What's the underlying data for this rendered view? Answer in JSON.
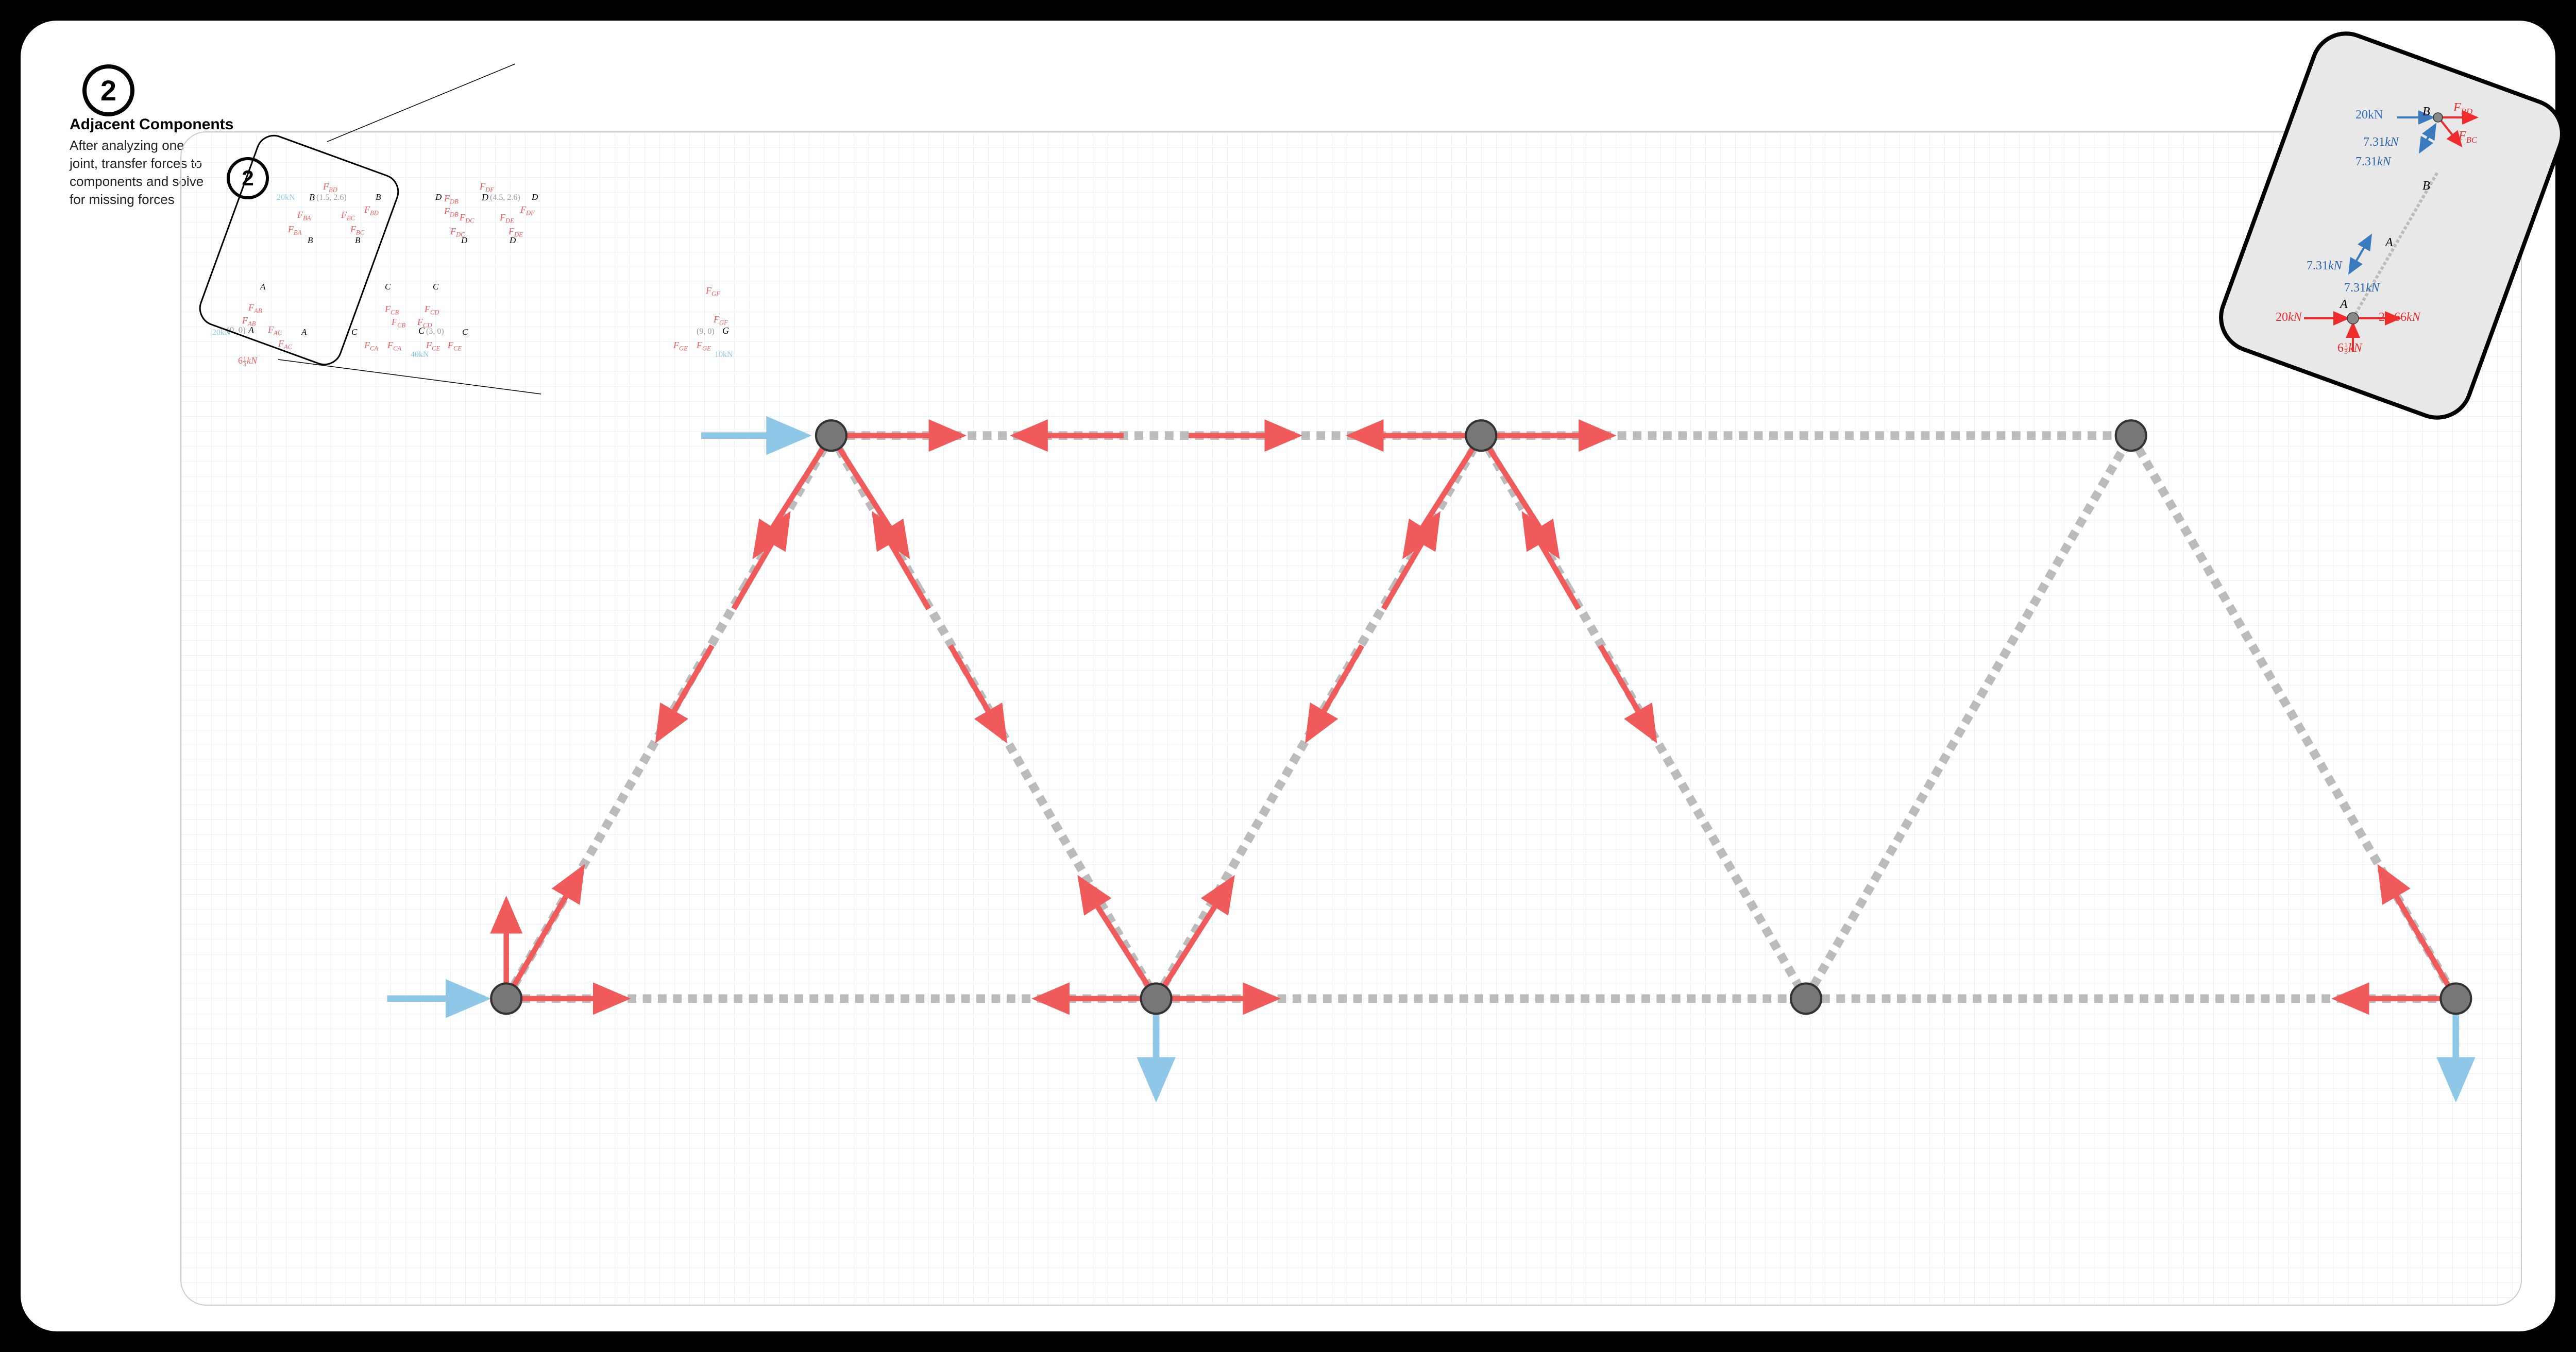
{
  "step": {
    "number": "2",
    "title": "Adjacent Components",
    "description": "After analyzing one joint, transfer forces to components and solve for missing forces"
  },
  "truss": {
    "joints": {
      "A": {
        "coord": "(0, 0)"
      },
      "B": {
        "coord": "(1.5, 2.6)"
      },
      "C": {
        "coord": "(3, 0)"
      },
      "D": {
        "coord": "(4.5, 2.6)"
      },
      "G": {
        "coord": "(9, 0)"
      }
    },
    "loads": {
      "Aext": "20kN",
      "Btop": "20kN",
      "Creact": "40kN",
      "Greact": "10kN",
      "Areact": "6⅓kN"
    },
    "forces": [
      "F_BD",
      "F_BA",
      "F_BC",
      "F_AB",
      "F_AC",
      "F_CA",
      "F_CE",
      "F_DB",
      "F_DF",
      "F_DC",
      "F_DE",
      "F_CB",
      "F_CD",
      "F_GF",
      "F_GE"
    ]
  },
  "zoom": {
    "A": "A",
    "B": "B",
    "FBD": "F_BD",
    "FBC": "F_BC",
    "v20": "20kN",
    "v731a": "7.31kN",
    "v731b": "7.31kN",
    "v731c": "7.31kN",
    "v731d": "7.31kN",
    "v2366": "23.66kN",
    "v613": "6⅓kN",
    "vA20": "20kN"
  },
  "lbl": {
    "A": "A",
    "B": "B",
    "C": "C",
    "D": "D",
    "G": "G",
    "FBD": "F",
    "BD": "BD",
    "FBA": "F",
    "BA": "BA",
    "FBC": "F",
    "BC": "BC",
    "FAB": "F",
    "AB": "AB",
    "FAC": "F",
    "AC": "AC",
    "FCA": "F",
    "CA": "CA",
    "FCE": "F",
    "CE": "CE",
    "FDB": "F",
    "DB": "DB",
    "FDF": "F",
    "DF": "DF",
    "FDC": "F",
    "DC": "DC",
    "FDE": "F",
    "DE": "DE",
    "FCB": "F",
    "CB": "CB",
    "FCD": "F",
    "CD": "CD",
    "FGF": "F",
    "GF": "GF",
    "FGE": "F",
    "GE": "GE"
  }
}
